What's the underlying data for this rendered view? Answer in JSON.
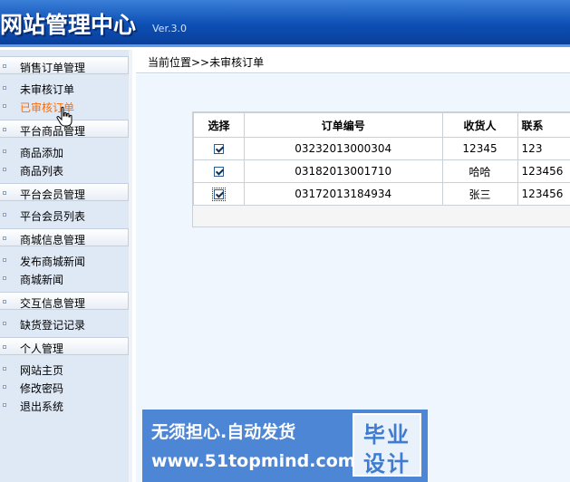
{
  "header": {
    "title": "网站管理中心",
    "version": "Ver.3.0"
  },
  "sidebar": {
    "items": [
      {
        "kind": "section",
        "label": "销售订单管理"
      },
      {
        "kind": "link",
        "label": "未审核订单"
      },
      {
        "kind": "link",
        "label": "已审核订单",
        "active": true
      },
      {
        "kind": "section",
        "label": "平台商品管理"
      },
      {
        "kind": "link",
        "label": "商品添加"
      },
      {
        "kind": "link",
        "label": "商品列表"
      },
      {
        "kind": "section",
        "label": "平台会员管理"
      },
      {
        "kind": "link",
        "label": "平台会员列表"
      },
      {
        "kind": "section",
        "label": "商城信息管理"
      },
      {
        "kind": "link",
        "label": "发布商城新闻"
      },
      {
        "kind": "link",
        "label": "商城新闻"
      },
      {
        "kind": "section",
        "label": "交互信息管理"
      },
      {
        "kind": "link",
        "label": "缺货登记记录"
      },
      {
        "kind": "section",
        "label": "个人管理"
      },
      {
        "kind": "link",
        "label": "网站主页"
      },
      {
        "kind": "link",
        "label": "修改密码"
      },
      {
        "kind": "link",
        "label": "退出系统"
      }
    ]
  },
  "main": {
    "breadcrumb": "当前位置>>未审核订单",
    "table": {
      "headers": [
        "选择",
        "订单编号",
        "收货人",
        "联系"
      ],
      "rows": [
        {
          "checked": true,
          "order_no": "03232013000304",
          "receiver": "12345",
          "contact": "123"
        },
        {
          "checked": true,
          "order_no": "03182013001710",
          "receiver": "哈哈",
          "contact": "123456"
        },
        {
          "checked": true,
          "order_no": "03172013184934",
          "receiver": "张三",
          "contact": "123456"
        }
      ]
    }
  },
  "banner": {
    "line1": "无须担心.自动发货",
    "line2": "www.51topmind.com",
    "badge_top": "毕业",
    "badge_bottom": "设计"
  },
  "colors": {
    "header_blue": "#0d4fb5",
    "active_link": "#ff6a00",
    "sidebar_bg": "#dfe9f6",
    "banner_bg": "#4e86d6"
  }
}
